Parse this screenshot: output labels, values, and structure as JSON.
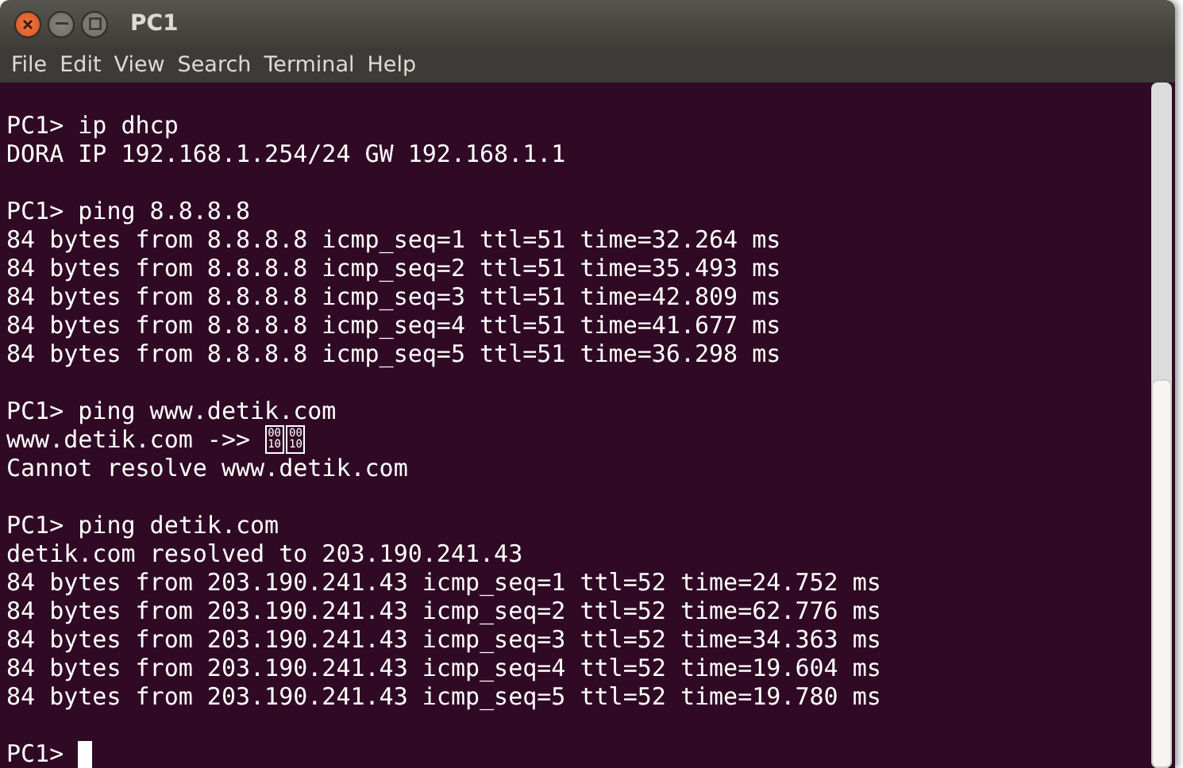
{
  "window": {
    "title": "PC1"
  },
  "menu": [
    "File",
    "Edit",
    "View",
    "Search",
    "Terminal",
    "Help"
  ],
  "terminal": {
    "blocks": [
      {
        "lines": [
          {
            "text": "PC1> ip dhcp"
          },
          {
            "text": "DORA IP 192.168.1.254/24 GW 192.168.1.1"
          }
        ]
      },
      {
        "lines": [
          {
            "text": "PC1> ping 8.8.8.8"
          },
          {
            "text": "84 bytes from 8.8.8.8 icmp_seq=1 ttl=51 time=32.264 ms"
          },
          {
            "text": "84 bytes from 8.8.8.8 icmp_seq=2 ttl=51 time=35.493 ms"
          },
          {
            "text": "84 bytes from 8.8.8.8 icmp_seq=3 ttl=51 time=42.809 ms"
          },
          {
            "text": "84 bytes from 8.8.8.8 icmp_seq=4 ttl=51 time=41.677 ms"
          },
          {
            "text": "84 bytes from 8.8.8.8 icmp_seq=5 ttl=51 time=36.298 ms"
          }
        ]
      },
      {
        "lines": [
          {
            "text": "PC1> ping www.detik.com"
          },
          {
            "text": "www.detik.com ->> ",
            "missing_glyphs": [
              [
                "00",
                "10"
              ],
              [
                "00",
                "10"
              ]
            ]
          },
          {
            "text": "Cannot resolve www.detik.com"
          }
        ]
      },
      {
        "lines": [
          {
            "text": "PC1> ping detik.com"
          },
          {
            "text": "detik.com resolved to 203.190.241.43"
          },
          {
            "text": "84 bytes from 203.190.241.43 icmp_seq=1 ttl=52 time=24.752 ms"
          },
          {
            "text": "84 bytes from 203.190.241.43 icmp_seq=2 ttl=52 time=62.776 ms"
          },
          {
            "text": "84 bytes from 203.190.241.43 icmp_seq=3 ttl=52 time=34.363 ms"
          },
          {
            "text": "84 bytes from 203.190.241.43 icmp_seq=4 ttl=52 time=19.604 ms"
          },
          {
            "text": "84 bytes from 203.190.241.43 icmp_seq=5 ttl=52 time=19.780 ms"
          }
        ]
      },
      {
        "lines": [
          {
            "text": "PC1> ",
            "cursor": true
          }
        ]
      }
    ]
  }
}
